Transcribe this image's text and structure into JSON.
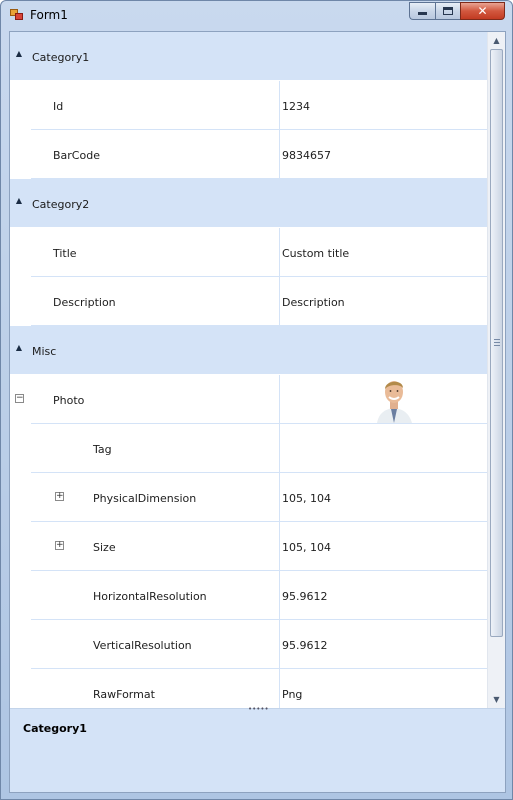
{
  "window": {
    "title": "Form1"
  },
  "caption_buttons": {
    "close_label": "✕"
  },
  "categories": [
    {
      "label": "Category1",
      "rows": [
        {
          "name": "Id",
          "value": "1234"
        },
        {
          "name": "BarCode",
          "value": "9834657"
        }
      ]
    },
    {
      "label": "Category2",
      "rows": [
        {
          "name": "Title",
          "value": "Custom title"
        },
        {
          "name": "Description",
          "value": "Description"
        }
      ]
    },
    {
      "label": "Misc",
      "rows": [
        {
          "name": "Photo",
          "value": ""
        },
        {
          "name": "Tag",
          "value": ""
        },
        {
          "name": "PhysicalDimension",
          "value": "105, 104"
        },
        {
          "name": "Size",
          "value": "105, 104"
        },
        {
          "name": "HorizontalResolution",
          "value": "95.9612"
        },
        {
          "name": "VerticalResolution",
          "value": "95.9612"
        },
        {
          "name": "RawFormat",
          "value": "Png"
        }
      ]
    }
  ],
  "help_panel": {
    "title": "Category1"
  },
  "colors": {
    "category_background": "#d4e3f7",
    "grid_lines": "#d4e3f7",
    "window_frame": "#b9cde7"
  }
}
